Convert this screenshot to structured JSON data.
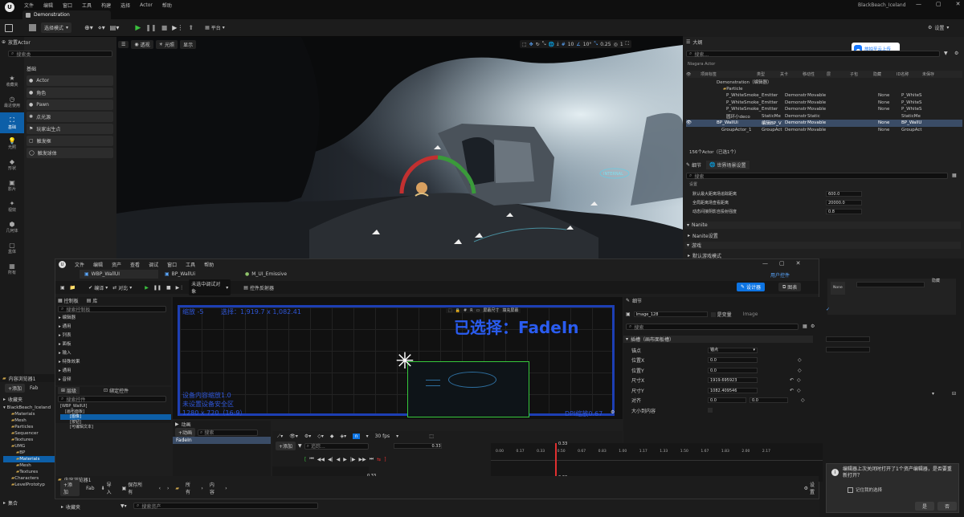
{
  "window": {
    "tab": "Demonstration",
    "project": "BlackBeach_Iceland"
  },
  "menu": [
    "文件",
    "编辑",
    "窗口",
    "工具",
    "构建",
    "选择",
    "Actor",
    "帮助"
  ],
  "toolbar": {
    "mode": "选择模式",
    "platform": "平台",
    "settings": "设置"
  },
  "viewport": {
    "view": "透视",
    "lit": "光照",
    "show": "显示",
    "grid": "10",
    "angle": "10°",
    "scale": "0.25",
    "cam": "1"
  },
  "place": {
    "title": "放置Actor",
    "search": "搜索类",
    "category": "基础",
    "items": [
      "Actor",
      "角色",
      "Pawn",
      "点光源",
      "玩家出生点",
      "触发框",
      "触发球体"
    ]
  },
  "leftnav": [
    "收藏夹",
    "最近使用",
    "基础",
    "光照",
    "形状",
    "影片",
    "视效",
    "几何体",
    "盒体",
    "所有"
  ],
  "outliner": {
    "title": "大纲",
    "search": "搜索...",
    "filter": "Niagara Actor",
    "cols": [
      "项目标签",
      "类型",
      "关卡",
      "移动性",
      "层",
      "子包",
      "隐藏",
      "ID名称",
      "未保存"
    ],
    "rows": [
      {
        "label": "Demonstration（编辑器）",
        "type": "",
        "level": "",
        "mob": "",
        "id": ""
      },
      {
        "label": "Particle",
        "type": "",
        "level": "",
        "mob": "",
        "id": ""
      },
      {
        "label": "P_WhiteSmoke_",
        "type": "Emitter",
        "level": "Demonstr",
        "mob": "Movable",
        "id": "P_WhiteS"
      },
      {
        "label": "P_WhiteSmoke_",
        "type": "Emitter",
        "level": "Demonstr",
        "mob": "Movable",
        "id": "P_WhiteS"
      },
      {
        "label": "P_WhiteSmoke_",
        "type": "Emitter",
        "level": "Demonstr",
        "mob": "Movable",
        "id": "P_WhiteS"
      },
      {
        "label": "圆环小deco",
        "type": "StaticMe",
        "level": "Demonstr",
        "mob": "Static",
        "id": "StaticMe"
      },
      {
        "label": "BP_WallUi",
        "type": "编辑BP_V",
        "level": "Demonstr",
        "mob": "Movable",
        "id": "BP_WallU"
      },
      {
        "label": "GroupActor_1",
        "type": "GroupAct",
        "level": "Demonstr",
        "mob": "Movable",
        "id": "GroupAct"
      }
    ],
    "footer": "156个Actor（已选1个）"
  },
  "upload": "旅拍至云上传",
  "details": {
    "tab1": "细节",
    "tab2": "世界场景设置",
    "search": "搜索",
    "section": "设置",
    "rows": [
      {
        "k": "默认最大距离场追踪距离",
        "v": "600.0"
      },
      {
        "k": "全局距离场查看距离",
        "v": "20000.0"
      },
      {
        "k": "动态间接阴影自投射强度",
        "v": "0.8"
      }
    ],
    "s2": "Nanite",
    "s3": "Nanite设置",
    "s4": "游戏",
    "s5": "默认游戏模式"
  },
  "umg": {
    "menu": [
      "文件",
      "编辑",
      "资产",
      "查看",
      "调试",
      "窗口",
      "工具",
      "帮助"
    ],
    "tabs": [
      "WBP_WallUI",
      "BP_WallUi",
      "M_UI_Emissive"
    ],
    "compile": "编译",
    "playoff": "对比",
    "debugsel": "未选中调试对象",
    "reflector": "控件反射器",
    "designer": "设计器",
    "graph": "图表",
    "usercontrol": "用户控件",
    "palette": "控制板",
    "library": "库",
    "palsearch": "搜索控制板",
    "palcats": [
      "编辑器",
      "通用",
      "列表",
      "面板",
      "输入",
      "特殊效果",
      "通用",
      "音频"
    ],
    "hier": "层级",
    "bind": "绑定控件",
    "hiersearch": "搜索控件",
    "tree": [
      "[WBP_WallUI]",
      "[画布面板]",
      "[图像]",
      "[按钮]",
      "[可编辑文本]"
    ],
    "zoom": "缩放 -5",
    "selinfo": "选择：1,919.7 x 1,082.41",
    "selected": "已选择：FadeIn",
    "dev1": "设备内容缩放1.0",
    "dev2": "未设置设备安全区",
    "dev3": "1280 x 720（16:9）",
    "dpi": "DPI缩放0.67",
    "screen": "屏幕尺寸",
    "fill": "填充屏幕",
    "detailsTab": "细节",
    "widgetname": "Image_128",
    "isvar": "是变量",
    "image": "Image",
    "detsearch": "搜索",
    "slot": "插槽（画布面板槽）",
    "anchor": "锚点",
    "anchorv": "锚点",
    "posx": "位置X",
    "posxv": "0.0",
    "posy": "位置Y",
    "posyv": "0.0",
    "sizex": "尺寸X",
    "sizexv": "1919.695923",
    "sizey": "尺寸Y",
    "sizeyv": "1082.409546",
    "align": "对齐",
    "alignv1": "0.0",
    "alignv2": "0.0",
    "autosize": "大小到内容",
    "anim": "动画",
    "addanim": "+动画",
    "animsearch": "搜索",
    "animitem": "FadeIn",
    "add": "+添加",
    "track": "追踪...",
    "fps": "30 fps",
    "time": "0.33",
    "ticks": [
      "0.00",
      "0.17",
      "0.33",
      "0.50",
      "0.67",
      "0.83",
      "1.00",
      "1.17",
      "1.33",
      "1.50",
      "1.67",
      "1.83",
      "2.00",
      "2.17"
    ]
  },
  "content": {
    "title": "内容浏览器1",
    "add": "+添加",
    "fab": "Fab",
    "import": "导入",
    "saveall": "保存所有",
    "path": [
      "所有",
      "内容"
    ],
    "settings": "设置",
    "fav": "收藏夹",
    "search": "搜索资产",
    "collection": "集合",
    "tree": [
      "收藏夹",
      "BlackBeach_Iceland",
      "Materials",
      "Mesh",
      "Particles",
      "Sequencer",
      "Textures",
      "UMG",
      "BP",
      "Materials",
      "Mesh",
      "Textures",
      "Characters",
      "LevelPrototyp"
    ]
  },
  "leftcb": {
    "title": "内容浏览器1",
    "add": "+添加",
    "fab": "Fab",
    "fav": "收藏夹",
    "tree": [
      "BlackBeach_Iceland",
      "Materials",
      "Mesh",
      "Particles",
      "Sequencer",
      "Textures",
      "UMG",
      "BP",
      "Materials",
      "Mesh",
      "Textures",
      "Characters",
      "LevelPrototyp"
    ],
    "collection": "集合"
  },
  "rl": {
    "none": "None",
    "hide": "隐藏",
    "yes": "是",
    "no": "否"
  },
  "dialog": {
    "text": "编辑器上次关闭时打开了1个资产编辑器，是否要重新打开？",
    "remember": "记住我的选择",
    "yes": "是",
    "no": "否"
  },
  "colors": {
    "accent": "#0d74e3",
    "selection": "#1a3b66",
    "green": "#36c83b",
    "red": "#e03030",
    "blue": "#2f6fe0"
  }
}
